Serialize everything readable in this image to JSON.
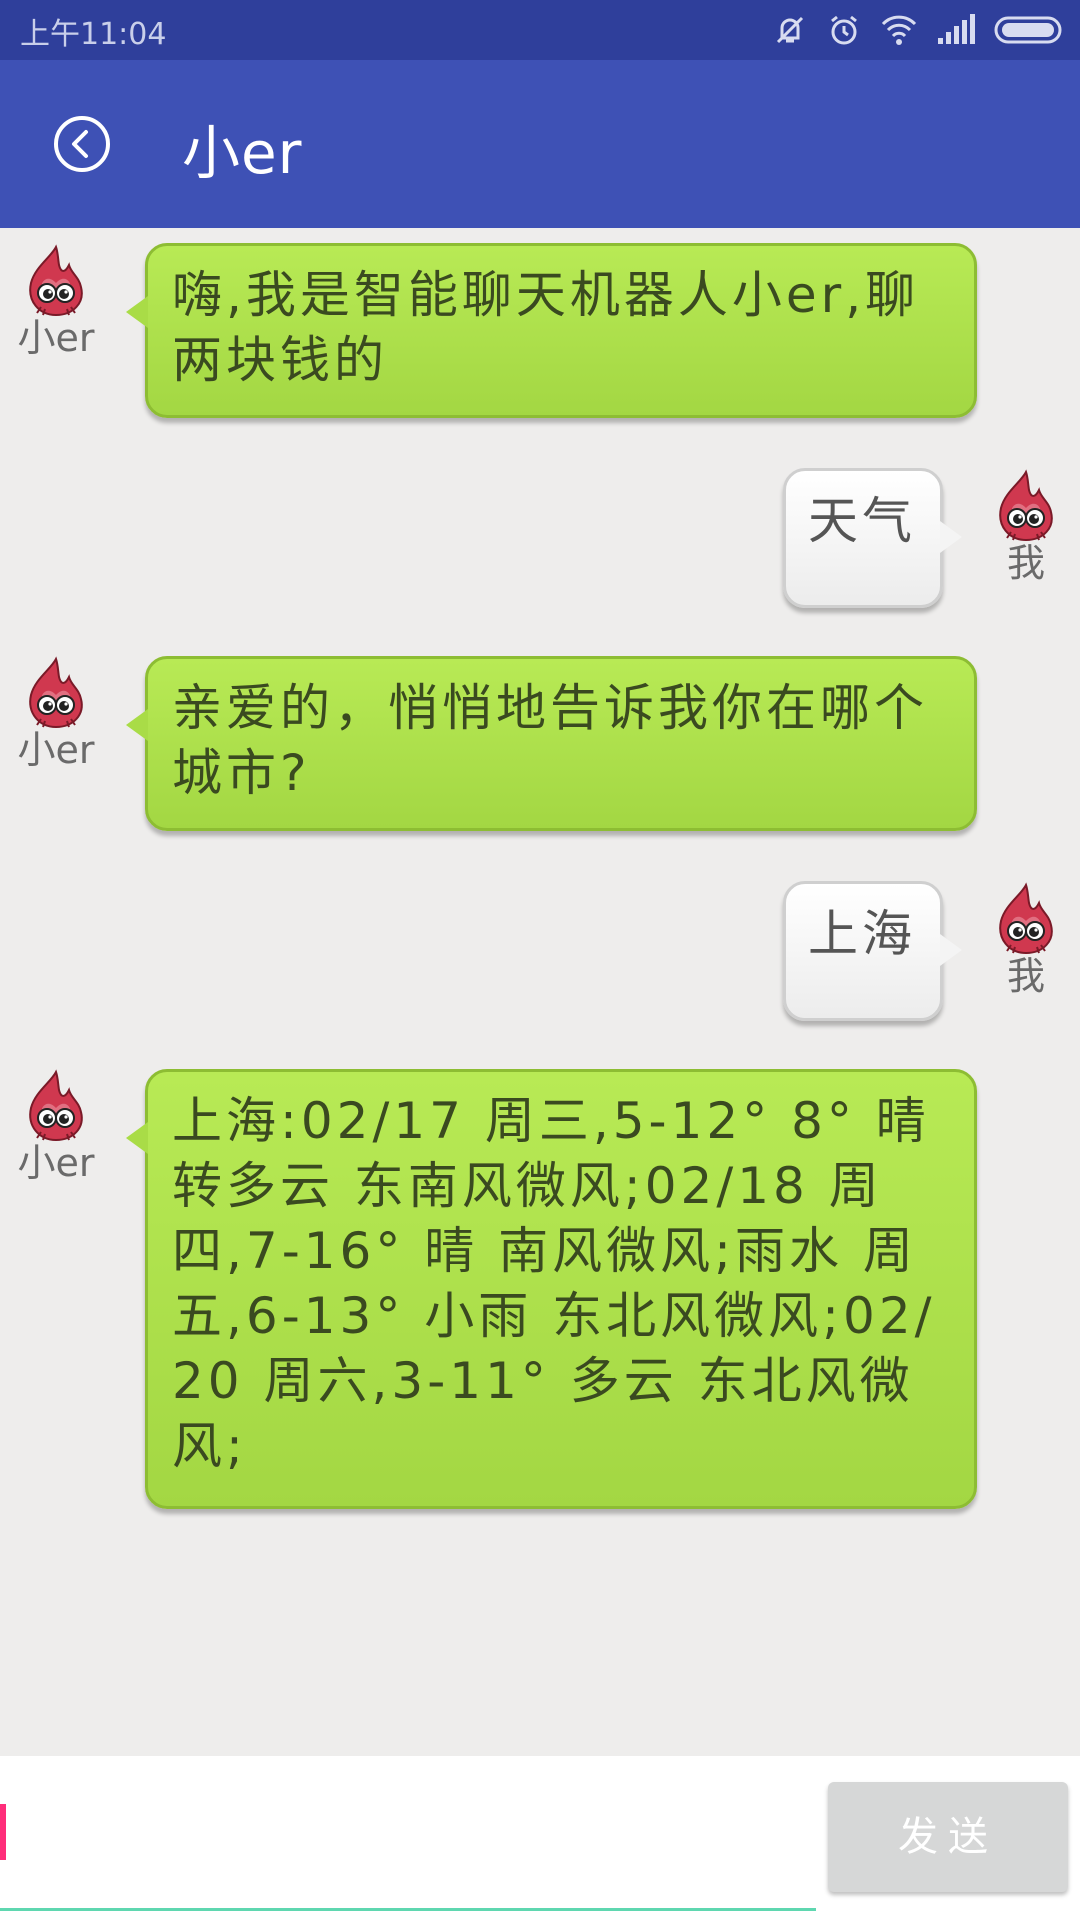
{
  "status_bar": {
    "time": "上午11:04"
  },
  "header": {
    "title": "小er"
  },
  "messages": [
    {
      "sender": "bot",
      "name": "小er",
      "text": "嗨,我是智能聊天机器人小er,聊两块钱的"
    },
    {
      "sender": "user",
      "name": "我",
      "text": "天气"
    },
    {
      "sender": "bot",
      "name": "小er",
      "text": "亲爱的，悄悄地告诉我你在哪个城市?"
    },
    {
      "sender": "user",
      "name": "我",
      "text": "上海"
    },
    {
      "sender": "bot",
      "name": "小er",
      "text": "上海:02/17 周三,5-12° 8° 晴转多云 东南风微风;02/18 周四,7-16° 晴 南风微风;雨水 周五,6-13° 小雨 东北风微风;02/20 周六,3-11° 多云 东北风微风;"
    }
  ],
  "input": {
    "value": "",
    "placeholder": ""
  },
  "send_button": {
    "label": "发送"
  },
  "colors": {
    "status_bar": "#2f3f9b",
    "app_bar": "#3e51b5",
    "bot_bubble": "#aadd47",
    "user_bubble": "#f6f6f6",
    "cursor": "#ff2d7a",
    "underline": "#5fd7b0"
  }
}
